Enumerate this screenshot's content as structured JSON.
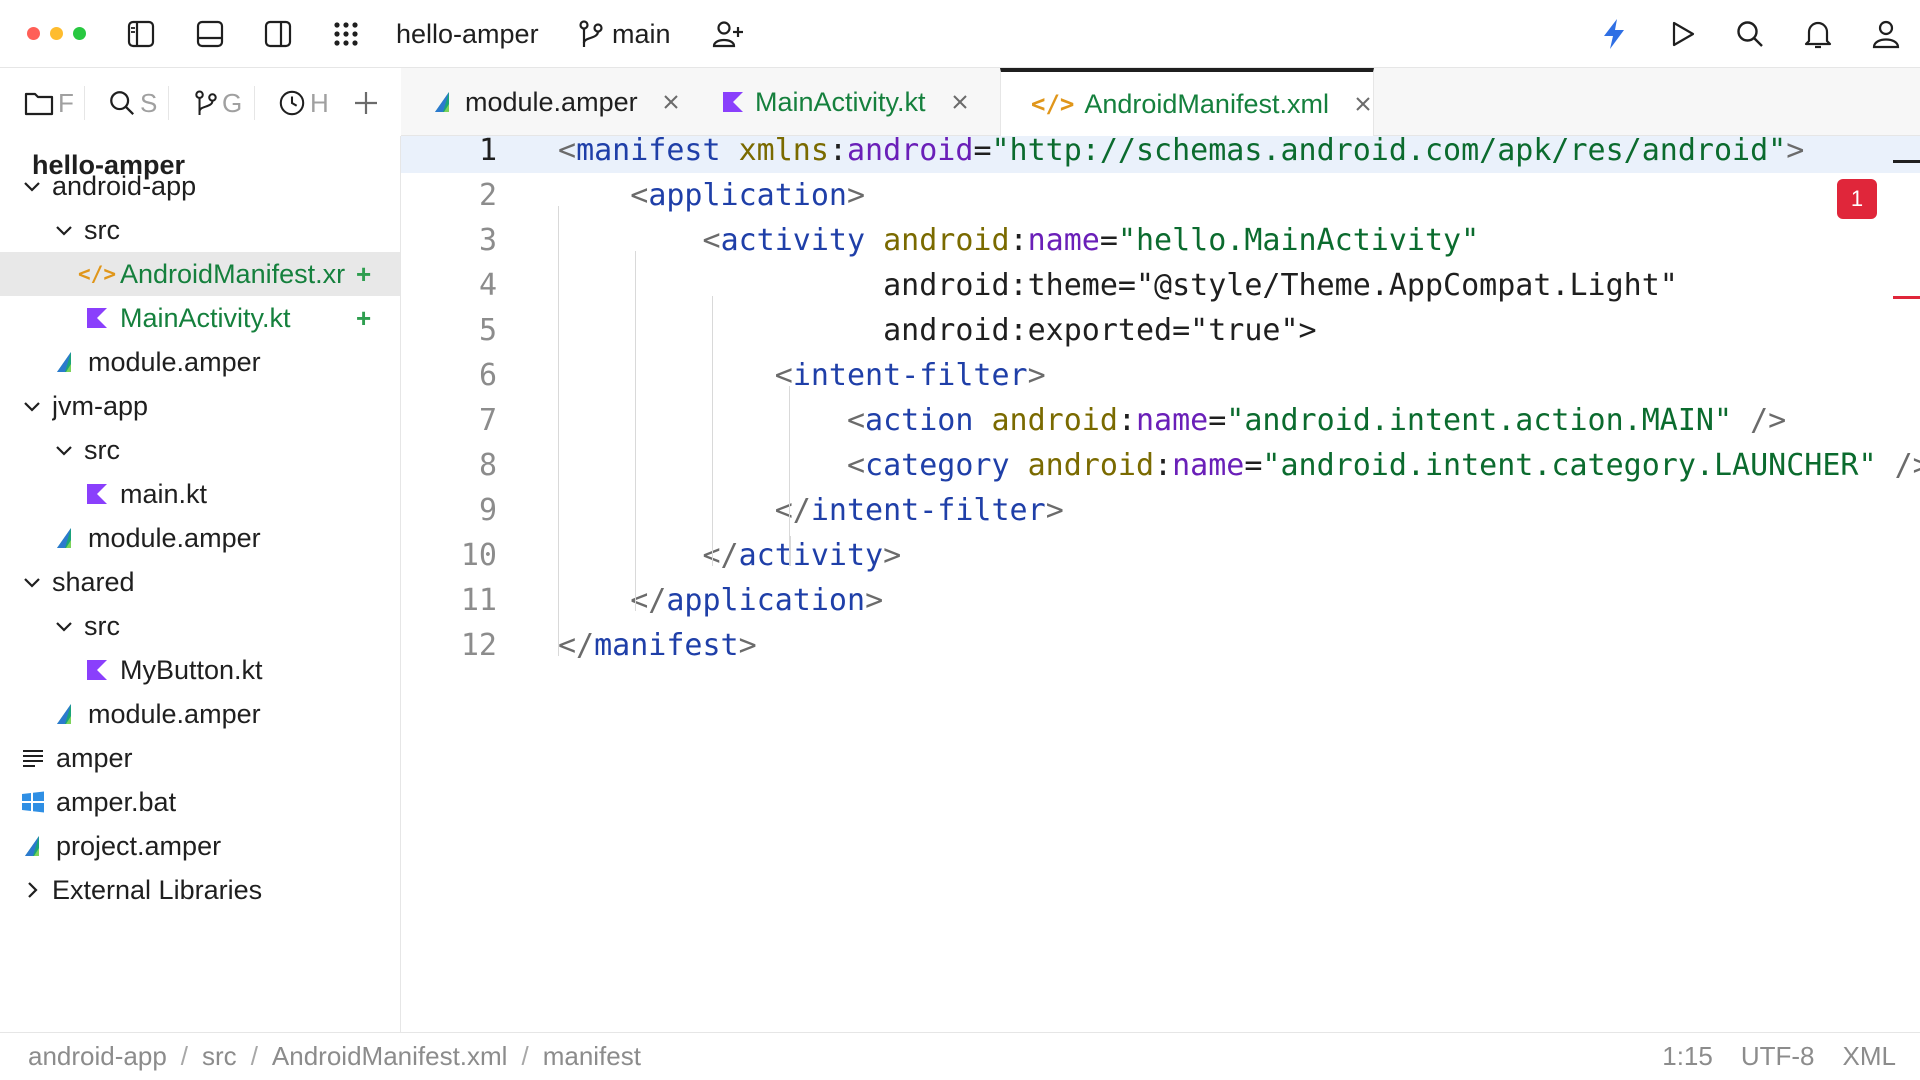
{
  "toolbar": {
    "project": "hello-amper",
    "branch": "main",
    "icons": [
      "sidebar-left-icon",
      "panel-bottom-icon",
      "sidebar-right-icon",
      "apps-grid-icon",
      "branch-icon",
      "add-user-icon",
      "lightning-icon",
      "run-icon",
      "search-icon",
      "bell-icon",
      "user-icon"
    ],
    "accent": "#2f6fe4"
  },
  "left_tabs": [
    {
      "icon": "folder-icon",
      "label": "F"
    },
    {
      "icon": "search-icon",
      "label": "S"
    },
    {
      "icon": "branch-icon",
      "label": "G"
    },
    {
      "icon": "clock-icon",
      "label": "H"
    },
    {
      "icon": "plus-icon",
      "label": ""
    }
  ],
  "sidebar": {
    "title": "hello-amper",
    "items": [
      {
        "label": "android-app",
        "icon": "",
        "chevron": "down"
      },
      {
        "label": "src",
        "icon": "",
        "chevron": "down"
      },
      {
        "label": "AndroidManifest.xr",
        "icon": "xml-icon",
        "chevron": "",
        "status": "+",
        "selected": true
      },
      {
        "label": "MainActivity.kt",
        "icon": "kotlin-icon",
        "chevron": "",
        "status": "+"
      },
      {
        "label": "module.amper",
        "icon": "amper-icon",
        "chevron": ""
      },
      {
        "label": "jvm-app",
        "icon": "",
        "chevron": "down"
      },
      {
        "label": "src",
        "icon": "",
        "chevron": "down"
      },
      {
        "label": "main.kt",
        "icon": "kotlin-icon",
        "chevron": ""
      },
      {
        "label": "module.amper",
        "icon": "amper-icon",
        "chevron": ""
      },
      {
        "label": "shared",
        "icon": "",
        "chevron": "down"
      },
      {
        "label": "src",
        "icon": "",
        "chevron": "down"
      },
      {
        "label": "MyButton.kt",
        "icon": "kotlin-icon",
        "chevron": ""
      },
      {
        "label": "module.amper",
        "icon": "amper-icon",
        "chevron": ""
      },
      {
        "label": "amper",
        "icon": "text-file-icon",
        "chevron": ""
      },
      {
        "label": "amper.bat",
        "icon": "windows-icon",
        "chevron": ""
      },
      {
        "label": "project.amper",
        "icon": "amper-icon",
        "chevron": ""
      },
      {
        "label": "External Libraries",
        "icon": "",
        "chevron": "right"
      }
    ]
  },
  "editor_tabs": [
    {
      "label": "module.amper",
      "icon": "amper-icon",
      "active": false
    },
    {
      "label": "MainActivity.kt",
      "icon": "kotlin-icon",
      "active": false
    },
    {
      "label": "AndroidManifest.xml",
      "icon": "xml-icon",
      "active": true
    }
  ],
  "editor": {
    "current_line": 1,
    "problem_count": "1",
    "lines": [
      {
        "num": "1",
        "text": "<manifest xmlns:android=\"http://schemas.android.com/apk/res/android\">"
      },
      {
        "num": "2",
        "text": "    <application>"
      },
      {
        "num": "3",
        "text": "        <activity android:name=\"hello.MainActivity\""
      },
      {
        "num": "4",
        "text": "                  android:theme=\"@style/Theme.AppCompat.Light\""
      },
      {
        "num": "5",
        "text": "                  android:exported=\"true\">"
      },
      {
        "num": "6",
        "text": "            <intent-filter>"
      },
      {
        "num": "7",
        "text": "                <action android:name=\"android.intent.action.MAIN\" />"
      },
      {
        "num": "8",
        "text": "                <category android:name=\"android.intent.category.LAUNCHER\" />"
      },
      {
        "num": "9",
        "text": "            </intent-filter>"
      },
      {
        "num": "10",
        "text": "        </activity>"
      },
      {
        "num": "11",
        "text": "    </application>"
      },
      {
        "num": "12",
        "text": "</manifest>"
      }
    ],
    "colors": {
      "tag": "#1f3fa8",
      "attr": "#7a6a00",
      "namespace": "#6a1fb8",
      "value": "#0b6b2e",
      "error": "#e0263a"
    }
  },
  "statusbar": {
    "breadcrumbs": [
      "android-app",
      "src",
      "AndroidManifest.xml",
      "manifest"
    ],
    "position": "1:15",
    "encoding": "UTF-8",
    "language": "XML"
  }
}
